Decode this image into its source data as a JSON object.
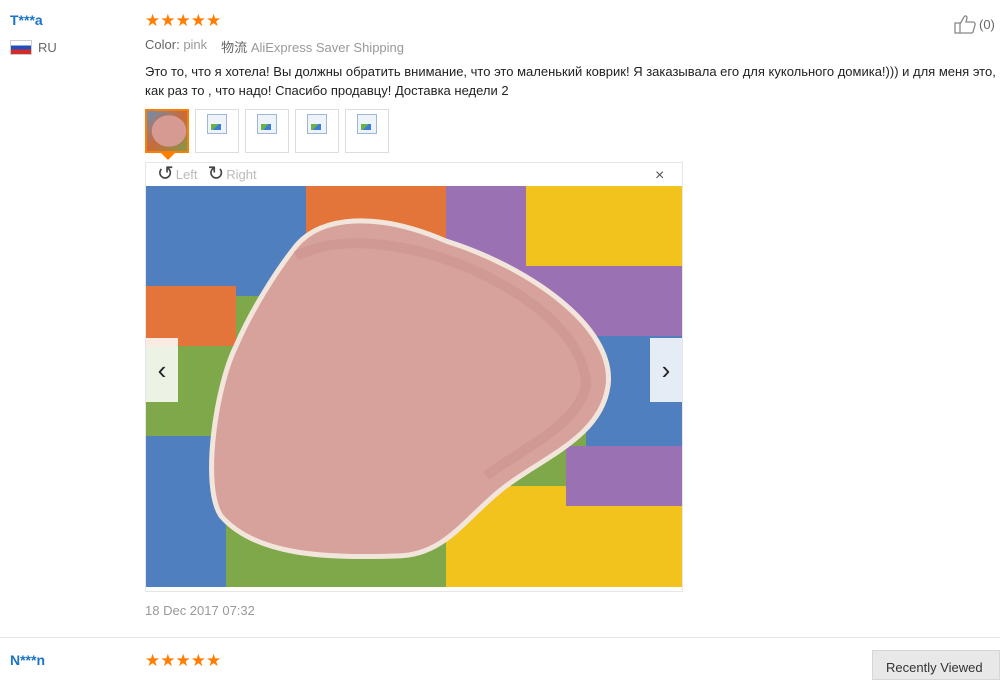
{
  "review1": {
    "user_name": "T***a",
    "country": "RU",
    "rating_stars": 5,
    "color_label": "Color:",
    "color_value": "pink",
    "shipping_label": "物流",
    "shipping_value": "AliExpress Saver Shipping",
    "text": "Это то, что я хотела! Вы должны обратить внимание, что это маленький коврик! Я заказывала его для кукольного домика!))) и для меня это, как раз то , что надо! Спасибо продавцу! Доставка недели 2",
    "helpful_count": "(0)",
    "date": "18 Dec 2017 07:32",
    "thumbnails": [
      "photo",
      "broken",
      "broken",
      "broken",
      "broken"
    ]
  },
  "viewer": {
    "rotate_left": "Left",
    "rotate_right": "Right",
    "close_glyph": "×",
    "prev_glyph": "‹",
    "next_glyph": "›"
  },
  "review2": {
    "user_name": "N***n",
    "rating_stars": 5
  },
  "recently_viewed": "Recently Viewed",
  "colors": {
    "accent": "#ff7d00",
    "link": "#1a73c8"
  }
}
